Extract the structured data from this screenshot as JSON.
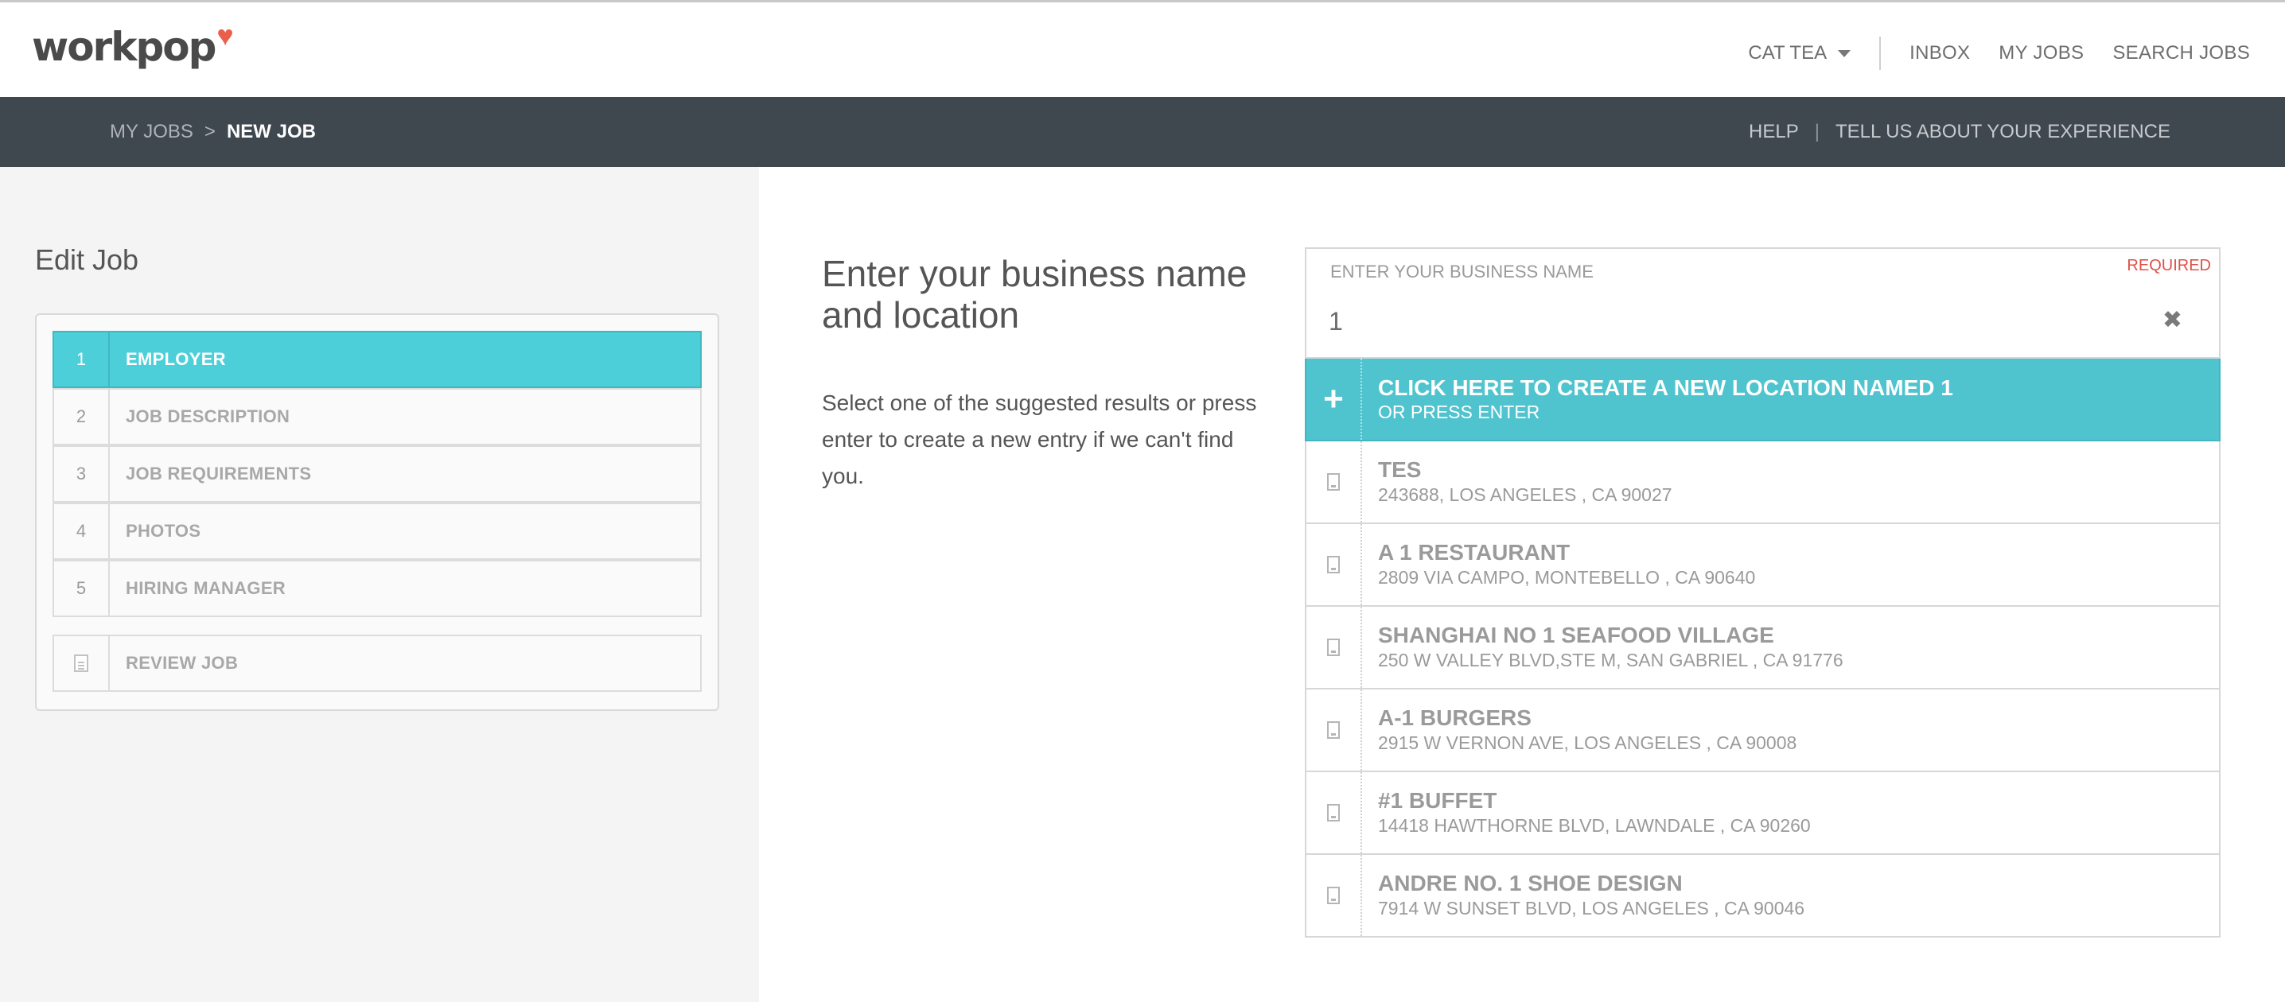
{
  "brand": {
    "name": "workpop",
    "heart_icon": "heart-icon",
    "heart_color": "#e8604c"
  },
  "topnav": {
    "user": "CAT TEA",
    "items": [
      "INBOX",
      "MY JOBS",
      "SEARCH JOBS"
    ]
  },
  "breadcrumb": {
    "parent": "MY JOBS",
    "separator": ">",
    "current": "NEW JOB"
  },
  "subnav": {
    "help": "HELP",
    "separator": "|",
    "feedback": "TELL US ABOUT YOUR EXPERIENCE"
  },
  "sidebar": {
    "title": "Edit Job",
    "steps": [
      {
        "num": "1",
        "label": "EMPLOYER",
        "active": true
      },
      {
        "num": "2",
        "label": "JOB DESCRIPTION",
        "active": false
      },
      {
        "num": "3",
        "label": "JOB REQUIREMENTS",
        "active": false
      },
      {
        "num": "4",
        "label": "PHOTOS",
        "active": false
      },
      {
        "num": "5",
        "label": "HIRING MANAGER",
        "active": false
      }
    ],
    "review": {
      "icon": "document-icon",
      "label": "REVIEW JOB"
    }
  },
  "main": {
    "title": "Enter your business name and location",
    "body": "Select one of the suggested results or press enter to create a new entry if we can't find you."
  },
  "business_field": {
    "label": "ENTER YOUR BUSINESS NAME",
    "required": "REQUIRED",
    "value": "1",
    "clear_icon": "close-icon"
  },
  "create_option": {
    "icon": "plus-icon",
    "title": "CLICK HERE TO CREATE A NEW LOCATION NAMED 1",
    "subtitle": "OR PRESS ENTER"
  },
  "results": [
    {
      "name": "TES",
      "address": "243688, LOS ANGELES , CA 90027"
    },
    {
      "name": "A 1 RESTAURANT",
      "address": "2809 VIA CAMPO, MONTEBELLO , CA 90640"
    },
    {
      "name": "SHANGHAI NO 1 SEAFOOD VILLAGE",
      "address": "250 W VALLEY BLVD,STE M, SAN GABRIEL , CA 91776"
    },
    {
      "name": "A-1 BURGERS",
      "address": "2915 W VERNON AVE, LOS ANGELES , CA 90008"
    },
    {
      "name": "#1 BUFFET",
      "address": "14418 HAWTHORNE BLVD, LAWNDALE , CA 90260"
    },
    {
      "name": "ANDRE NO. 1 SHOE DESIGN",
      "address": "7914 W SUNSET BLVD, LOS ANGELES , CA 90046"
    }
  ],
  "colors": {
    "accent": "#4fc4cf",
    "active_step": "#4ccfd9",
    "subbar": "#3f474f",
    "required": "#e0504a"
  }
}
